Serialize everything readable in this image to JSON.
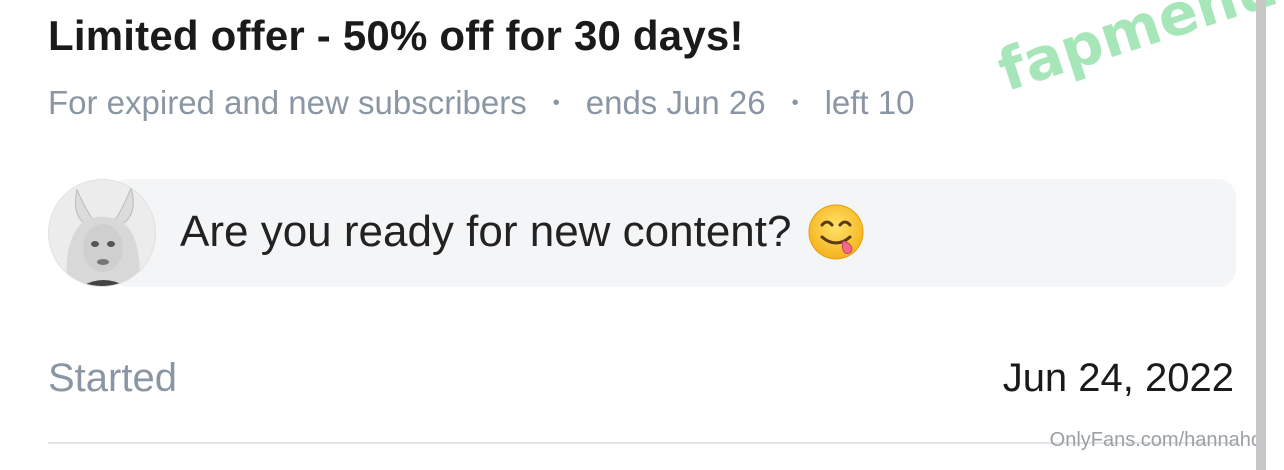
{
  "offer": {
    "title": "Limited offer - 50% off for 30 days!",
    "audience": "For expired and new subscribers",
    "ends": "ends Jun 26",
    "left": "left 10"
  },
  "message": {
    "text": "Are you ready for new content?",
    "emoji": "face-savoring-food-icon"
  },
  "started": {
    "label": "Started",
    "date": "Jun 24, 2022"
  },
  "watermark": "fapmenu.com",
  "source_url": "OnlyFans.com/hannaho",
  "colors": {
    "title": "#1a1a1a",
    "muted": "#8a96a3",
    "bubble": "#f4f5f6",
    "watermark": "#8fe0a6"
  }
}
